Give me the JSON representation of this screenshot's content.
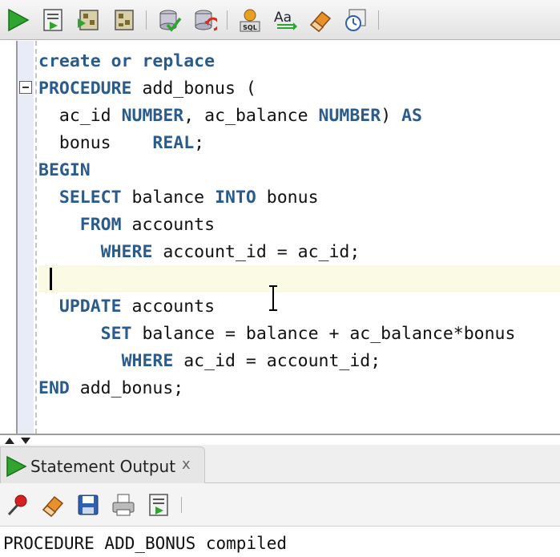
{
  "toolbar": {
    "buttons": [
      {
        "name": "run-statement-icon"
      },
      {
        "name": "run-script-icon"
      },
      {
        "name": "autotrace-icon"
      },
      {
        "name": "explain-plan-icon"
      },
      {
        "name": "commit-icon"
      },
      {
        "name": "rollback-icon"
      },
      {
        "name": "sql-tuning-advisor-icon"
      },
      {
        "name": "to-upper-lower-icon"
      },
      {
        "name": "clear-icon"
      },
      {
        "name": "sql-history-icon"
      }
    ]
  },
  "editor": {
    "lines": [
      {
        "indent": "",
        "tokens": [
          {
            "t": "create or replace",
            "k": true
          }
        ]
      },
      {
        "indent": "",
        "tokens": [
          {
            "t": "PROCEDURE",
            "k": true
          },
          {
            "t": " add_bonus (",
            "k": false
          }
        ]
      },
      {
        "indent": "  ",
        "tokens": [
          {
            "t": "ac_id ",
            "k": false
          },
          {
            "t": "NUMBER",
            "k": true
          },
          {
            "t": ", ac_balance ",
            "k": false
          },
          {
            "t": "NUMBER",
            "k": true
          },
          {
            "t": ") ",
            "k": false
          },
          {
            "t": "AS",
            "k": true
          }
        ]
      },
      {
        "indent": "  ",
        "tokens": [
          {
            "t": "bonus    ",
            "k": false
          },
          {
            "t": "REAL",
            "k": true
          },
          {
            "t": ";",
            "k": false
          }
        ]
      },
      {
        "indent": "",
        "tokens": [
          {
            "t": "BEGIN",
            "k": true
          }
        ]
      },
      {
        "indent": "  ",
        "tokens": [
          {
            "t": "SELECT",
            "k": true
          },
          {
            "t": " balance ",
            "k": false
          },
          {
            "t": "INTO",
            "k": true
          },
          {
            "t": " bonus",
            "k": false
          }
        ]
      },
      {
        "indent": "    ",
        "tokens": [
          {
            "t": "FROM",
            "k": true
          },
          {
            "t": " accounts",
            "k": false
          }
        ]
      },
      {
        "indent": "      ",
        "tokens": [
          {
            "t": "WHERE",
            "k": true
          },
          {
            "t": " account_id = ac_id;",
            "k": false
          }
        ]
      },
      {
        "indent": "",
        "tokens": []
      },
      {
        "indent": "  ",
        "tokens": [
          {
            "t": "UPDATE",
            "k": true
          },
          {
            "t": " accounts",
            "k": false
          }
        ]
      },
      {
        "indent": "      ",
        "tokens": [
          {
            "t": "SET",
            "k": true
          },
          {
            "t": " balance = balance + ac_balance*bonus",
            "k": false
          }
        ]
      },
      {
        "indent": "        ",
        "tokens": [
          {
            "t": "WHERE",
            "k": true
          },
          {
            "t": " ac_id = account_id;",
            "k": false
          }
        ]
      },
      {
        "indent": "",
        "tokens": [
          {
            "t": "END",
            "k": true
          },
          {
            "t": " add_bonus;",
            "k": false
          }
        ]
      }
    ]
  },
  "output_panel": {
    "tab_label": "Statement Output",
    "close_label": "x",
    "toolbar_buttons": [
      {
        "name": "pin-icon"
      },
      {
        "name": "clear-output-icon"
      },
      {
        "name": "save-icon"
      },
      {
        "name": "print-icon"
      },
      {
        "name": "run-script-output-icon"
      }
    ],
    "message": "PROCEDURE ADD_BONUS compiled"
  }
}
